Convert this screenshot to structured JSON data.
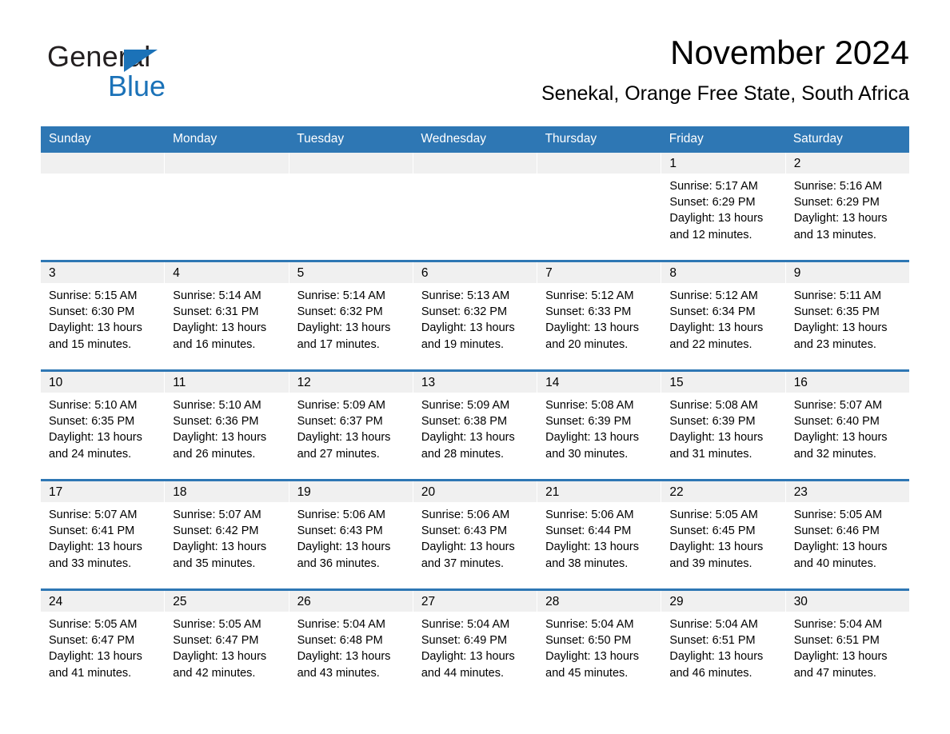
{
  "brand": {
    "word1": "General",
    "word2": "Blue",
    "triangle_color": "#1b72b8",
    "text_color": "#231f20"
  },
  "header": {
    "title": "November 2024",
    "subtitle": "Senekal, Orange Free State, South Africa"
  },
  "theme": {
    "header_blue": "#2e77b4",
    "day_number_band": "#f0f0f0",
    "cell_background": "#ffffff",
    "text": "#000000"
  },
  "weekdays": [
    "Sunday",
    "Monday",
    "Tuesday",
    "Wednesday",
    "Thursday",
    "Friday",
    "Saturday"
  ],
  "weeks": [
    [
      {
        "day": "",
        "lines": []
      },
      {
        "day": "",
        "lines": []
      },
      {
        "day": "",
        "lines": []
      },
      {
        "day": "",
        "lines": []
      },
      {
        "day": "",
        "lines": []
      },
      {
        "day": "1",
        "lines": [
          "Sunrise: 5:17 AM",
          "Sunset: 6:29 PM",
          "Daylight: 13 hours",
          "and 12 minutes."
        ]
      },
      {
        "day": "2",
        "lines": [
          "Sunrise: 5:16 AM",
          "Sunset: 6:29 PM",
          "Daylight: 13 hours",
          "and 13 minutes."
        ]
      }
    ],
    [
      {
        "day": "3",
        "lines": [
          "Sunrise: 5:15 AM",
          "Sunset: 6:30 PM",
          "Daylight: 13 hours",
          "and 15 minutes."
        ]
      },
      {
        "day": "4",
        "lines": [
          "Sunrise: 5:14 AM",
          "Sunset: 6:31 PM",
          "Daylight: 13 hours",
          "and 16 minutes."
        ]
      },
      {
        "day": "5",
        "lines": [
          "Sunrise: 5:14 AM",
          "Sunset: 6:32 PM",
          "Daylight: 13 hours",
          "and 17 minutes."
        ]
      },
      {
        "day": "6",
        "lines": [
          "Sunrise: 5:13 AM",
          "Sunset: 6:32 PM",
          "Daylight: 13 hours",
          "and 19 minutes."
        ]
      },
      {
        "day": "7",
        "lines": [
          "Sunrise: 5:12 AM",
          "Sunset: 6:33 PM",
          "Daylight: 13 hours",
          "and 20 minutes."
        ]
      },
      {
        "day": "8",
        "lines": [
          "Sunrise: 5:12 AM",
          "Sunset: 6:34 PM",
          "Daylight: 13 hours",
          "and 22 minutes."
        ]
      },
      {
        "day": "9",
        "lines": [
          "Sunrise: 5:11 AM",
          "Sunset: 6:35 PM",
          "Daylight: 13 hours",
          "and 23 minutes."
        ]
      }
    ],
    [
      {
        "day": "10",
        "lines": [
          "Sunrise: 5:10 AM",
          "Sunset: 6:35 PM",
          "Daylight: 13 hours",
          "and 24 minutes."
        ]
      },
      {
        "day": "11",
        "lines": [
          "Sunrise: 5:10 AM",
          "Sunset: 6:36 PM",
          "Daylight: 13 hours",
          "and 26 minutes."
        ]
      },
      {
        "day": "12",
        "lines": [
          "Sunrise: 5:09 AM",
          "Sunset: 6:37 PM",
          "Daylight: 13 hours",
          "and 27 minutes."
        ]
      },
      {
        "day": "13",
        "lines": [
          "Sunrise: 5:09 AM",
          "Sunset: 6:38 PM",
          "Daylight: 13 hours",
          "and 28 minutes."
        ]
      },
      {
        "day": "14",
        "lines": [
          "Sunrise: 5:08 AM",
          "Sunset: 6:39 PM",
          "Daylight: 13 hours",
          "and 30 minutes."
        ]
      },
      {
        "day": "15",
        "lines": [
          "Sunrise: 5:08 AM",
          "Sunset: 6:39 PM",
          "Daylight: 13 hours",
          "and 31 minutes."
        ]
      },
      {
        "day": "16",
        "lines": [
          "Sunrise: 5:07 AM",
          "Sunset: 6:40 PM",
          "Daylight: 13 hours",
          "and 32 minutes."
        ]
      }
    ],
    [
      {
        "day": "17",
        "lines": [
          "Sunrise: 5:07 AM",
          "Sunset: 6:41 PM",
          "Daylight: 13 hours",
          "and 33 minutes."
        ]
      },
      {
        "day": "18",
        "lines": [
          "Sunrise: 5:07 AM",
          "Sunset: 6:42 PM",
          "Daylight: 13 hours",
          "and 35 minutes."
        ]
      },
      {
        "day": "19",
        "lines": [
          "Sunrise: 5:06 AM",
          "Sunset: 6:43 PM",
          "Daylight: 13 hours",
          "and 36 minutes."
        ]
      },
      {
        "day": "20",
        "lines": [
          "Sunrise: 5:06 AM",
          "Sunset: 6:43 PM",
          "Daylight: 13 hours",
          "and 37 minutes."
        ]
      },
      {
        "day": "21",
        "lines": [
          "Sunrise: 5:06 AM",
          "Sunset: 6:44 PM",
          "Daylight: 13 hours",
          "and 38 minutes."
        ]
      },
      {
        "day": "22",
        "lines": [
          "Sunrise: 5:05 AM",
          "Sunset: 6:45 PM",
          "Daylight: 13 hours",
          "and 39 minutes."
        ]
      },
      {
        "day": "23",
        "lines": [
          "Sunrise: 5:05 AM",
          "Sunset: 6:46 PM",
          "Daylight: 13 hours",
          "and 40 minutes."
        ]
      }
    ],
    [
      {
        "day": "24",
        "lines": [
          "Sunrise: 5:05 AM",
          "Sunset: 6:47 PM",
          "Daylight: 13 hours",
          "and 41 minutes."
        ]
      },
      {
        "day": "25",
        "lines": [
          "Sunrise: 5:05 AM",
          "Sunset: 6:47 PM",
          "Daylight: 13 hours",
          "and 42 minutes."
        ]
      },
      {
        "day": "26",
        "lines": [
          "Sunrise: 5:04 AM",
          "Sunset: 6:48 PM",
          "Daylight: 13 hours",
          "and 43 minutes."
        ]
      },
      {
        "day": "27",
        "lines": [
          "Sunrise: 5:04 AM",
          "Sunset: 6:49 PM",
          "Daylight: 13 hours",
          "and 44 minutes."
        ]
      },
      {
        "day": "28",
        "lines": [
          "Sunrise: 5:04 AM",
          "Sunset: 6:50 PM",
          "Daylight: 13 hours",
          "and 45 minutes."
        ]
      },
      {
        "day": "29",
        "lines": [
          "Sunrise: 5:04 AM",
          "Sunset: 6:51 PM",
          "Daylight: 13 hours",
          "and 46 minutes."
        ]
      },
      {
        "day": "30",
        "lines": [
          "Sunrise: 5:04 AM",
          "Sunset: 6:51 PM",
          "Daylight: 13 hours",
          "and 47 minutes."
        ]
      }
    ]
  ]
}
